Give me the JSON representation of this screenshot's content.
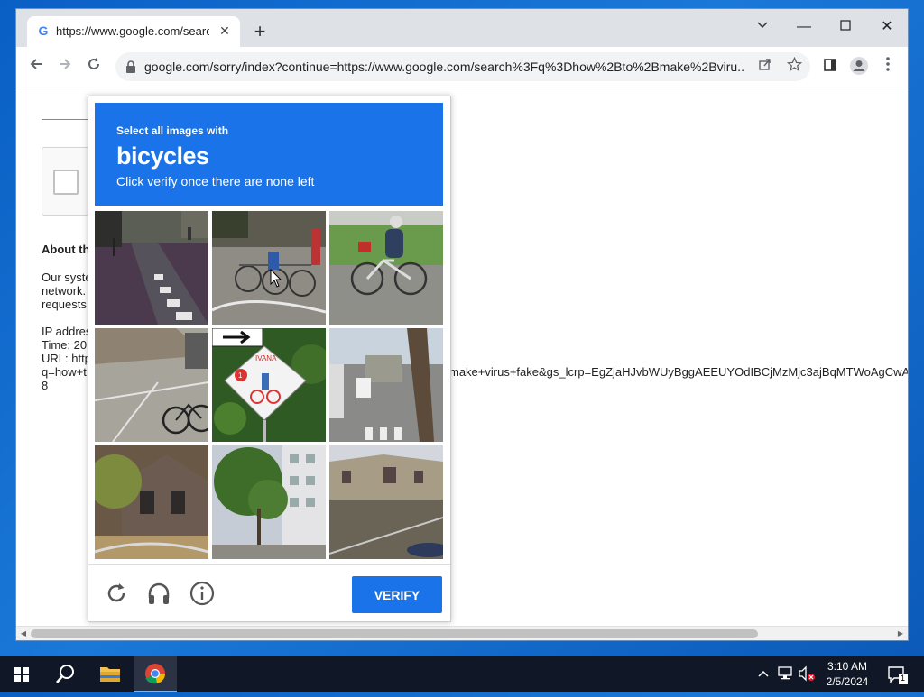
{
  "browser": {
    "tab": {
      "title": "https://www.google.com/search?q",
      "favicon": "G"
    },
    "url": "google.com/sorry/index?continue=https://www.google.com/search%3Fq%3Dhow%2Bto%2Bmake%2Bviru...",
    "window_controls": {
      "minimize": "—",
      "maximize": "☐",
      "close": "✕",
      "tab_list": "⌄"
    }
  },
  "page": {
    "heading": "About th",
    "paragraph": [
      "Our syste",
      "network.",
      "requests"
    ],
    "ip_label": "IP addres",
    "time_label": "Time: 20",
    "url_label": "URL: http",
    "url_cont": "q=how+t",
    "url_tail": "make+virus+fake&gs_lcrp=EgZjaHJvbWUyBggAEEUYOdIBCjMzMjc3ajBqMTWoAgCwA",
    "digit": "8"
  },
  "captcha": {
    "instruction_small": "Select all images with",
    "target": "bicycles",
    "instruction_sub": "Click verify once there are none left",
    "verify_label": "VERIFY",
    "tiles": [
      "bike-lane",
      "parked-bicycles",
      "cyclist",
      "street-bicycle",
      "bicycle-sign",
      "street-road",
      "brick-building",
      "city-street",
      "plaza-building"
    ]
  },
  "sign_text": {
    "top": "IVANA",
    "badge": "1"
  },
  "taskbar": {
    "time": "3:10 AM",
    "date": "2/5/2024",
    "notification_count": "1"
  }
}
